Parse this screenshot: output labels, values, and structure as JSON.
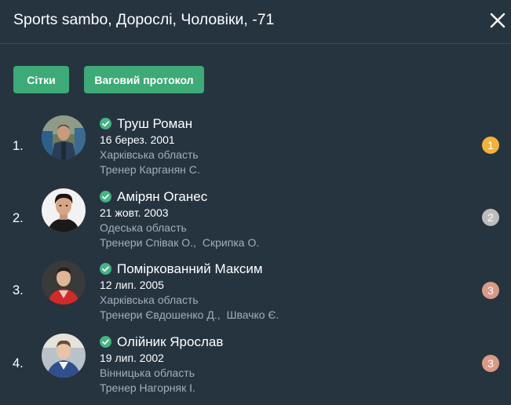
{
  "header": {
    "title": "Sports sambo, Дорослі, Чоловіки, -71",
    "close_icon": "close-icon"
  },
  "buttons": {
    "grids_label": "Сітки",
    "weigh_label": "Ваговий протокол",
    "color": "#3daa78"
  },
  "colors": {
    "background": "#263440",
    "secondary_text": "#a3aeb8",
    "check": "#46b485",
    "gold": "#f1b33d",
    "silver": "#bdbdbd",
    "bronze": "#d99a86"
  },
  "athletes": [
    {
      "place": "1.",
      "name": "Труш Роман",
      "dob": "16 берез. 2001",
      "region": "Харківська область",
      "coaches": [
        "Тренер Карганян С."
      ],
      "medal": "1",
      "medal_color": "#f1b33d",
      "verified_icon": "check-circle-icon"
    },
    {
      "place": "2.",
      "name": "Амірян Оганес",
      "dob": "21 жовт. 2003",
      "region": "Одеська область",
      "coaches": [
        "Тренери Співак О.,",
        "Скрипка О."
      ],
      "medal": "2",
      "medal_color": "#bdbdbd",
      "verified_icon": "check-circle-icon"
    },
    {
      "place": "3.",
      "name": "Поміркованний Максим",
      "dob": "12 лип. 2005",
      "region": "Харківська область",
      "coaches": [
        "Тренери Євдошенко Д.,",
        "Швачко Є."
      ],
      "medal": "3",
      "medal_color": "#d99a86",
      "verified_icon": "check-circle-icon"
    },
    {
      "place": "4.",
      "name": "Олійник Ярослав",
      "dob": "19 лип. 2002",
      "region": "Вінницька область",
      "coaches": [
        "Тренер Нагорняк І."
      ],
      "medal": "3",
      "medal_color": "#d99a86",
      "verified_icon": "check-circle-icon"
    }
  ]
}
